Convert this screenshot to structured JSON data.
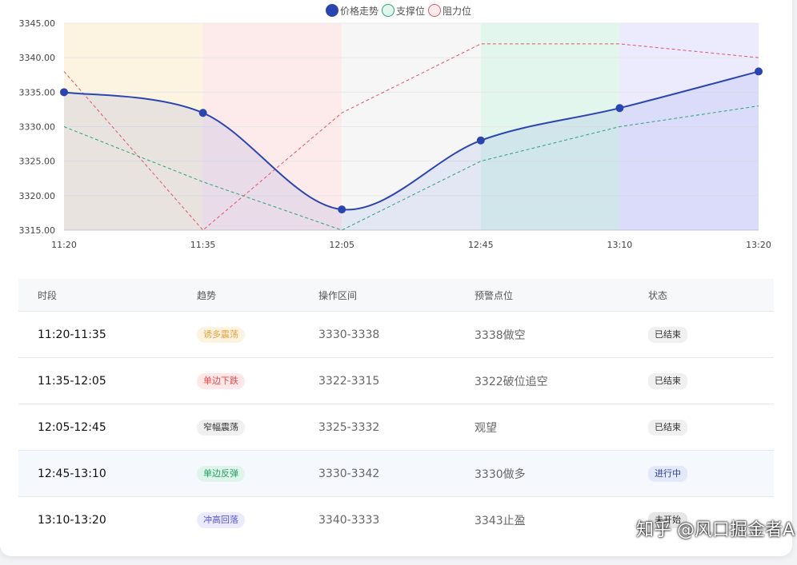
{
  "legend": [
    {
      "label": "价格走势",
      "color": "#2b45b0",
      "style": "filled"
    },
    {
      "label": "支撑位",
      "color": "#2aa37a",
      "style": "outline"
    },
    {
      "label": "阻力位",
      "color": "#e05565",
      "style": "outline"
    }
  ],
  "chart_data": {
    "type": "line",
    "x": [
      "11:20",
      "11:35",
      "12:05",
      "12:45",
      "13:10",
      "13:20"
    ],
    "ylim": [
      3315,
      3345
    ],
    "yticks": [
      "3345.00",
      "3340.00",
      "3335.00",
      "3330.00",
      "3325.00",
      "3320.00",
      "3315.00"
    ],
    "series": [
      {
        "name": "价格走势",
        "values": [
          3335,
          3332,
          3318,
          3328,
          3332.7,
          3338
        ],
        "color": "#2b45b0"
      },
      {
        "name": "支撑位",
        "values": [
          3330,
          3322,
          3315,
          3325,
          3330,
          3333
        ],
        "color": "#2aa37a"
      },
      {
        "name": "阻力位",
        "values": [
          3338,
          3315,
          3332,
          3342,
          3342,
          3340
        ],
        "color": "#e05565"
      }
    ],
    "bands": [
      {
        "color": "#fdf3e1"
      },
      {
        "color": "#fdeaea"
      },
      {
        "color": "#f6f6f6"
      },
      {
        "color": "#e2f6ee"
      },
      {
        "color": "#ecebfd"
      }
    ],
    "grid": true
  },
  "table": {
    "headers": [
      "时段",
      "趋势",
      "操作区间",
      "预警点位",
      "状态"
    ],
    "rows": [
      {
        "period": "11:20-11:35",
        "trend": "诱多震荡",
        "range": "3330-3338",
        "alert": "3338做空",
        "status": "已结束",
        "trend_color": "#e8a13c",
        "trend_bg": "#fdf3e1",
        "status_color": "#333",
        "status_bg": "#f0f0f0"
      },
      {
        "period": "11:35-12:05",
        "trend": "单边下跌",
        "range": "3322-3315",
        "alert": "3322破位追空",
        "status": "已结束",
        "trend_color": "#e04a4a",
        "trend_bg": "#fde7e7",
        "status_color": "#333",
        "status_bg": "#f0f0f0"
      },
      {
        "period": "12:05-12:45",
        "trend": "窄幅震荡",
        "range": "3325-3332",
        "alert": "观望",
        "status": "已结束",
        "trend_color": "#333",
        "trend_bg": "#f0f0f0",
        "status_color": "#333",
        "status_bg": "#f0f0f0"
      },
      {
        "period": "12:45-13:10",
        "trend": "单边反弹",
        "range": "3330-3342",
        "alert": "3330做多",
        "status": "进行中",
        "trend_color": "#1f9d63",
        "trend_bg": "#dff5ea",
        "status_color": "#2c3f9c",
        "status_bg": "#e3e9fb",
        "active": true
      },
      {
        "period": "13:10-13:20",
        "trend": "冲高回落",
        "range": "3340-3333",
        "alert": "3343止盈",
        "status": "未开始",
        "trend_color": "#5a55d6",
        "trend_bg": "#ecebfd",
        "status_color": "#333",
        "status_bg": "#e6e6e6"
      }
    ]
  },
  "watermark": "知乎 @风口掘金者A"
}
